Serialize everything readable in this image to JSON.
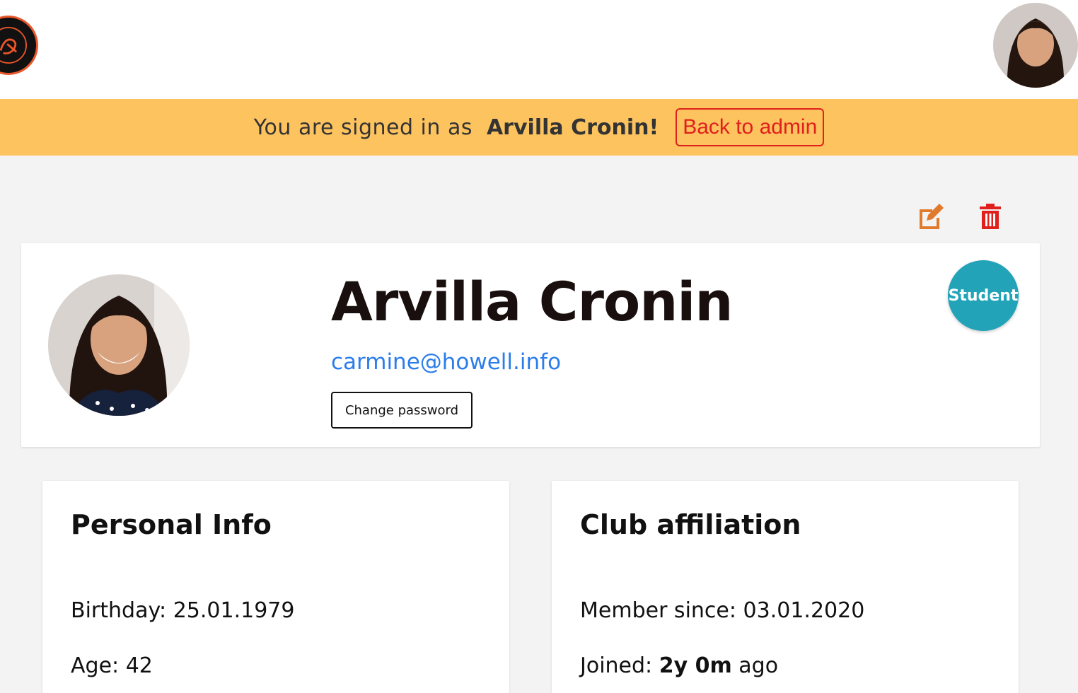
{
  "header": {
    "logo_icon": "club-logo-icon",
    "avatar_icon": "user-avatar"
  },
  "banner": {
    "prefix": "You are signed in as",
    "user": "Arvilla Cronin!",
    "back_label": "Back to admin",
    "color": "#fdc35f"
  },
  "actions": {
    "edit_icon": "edit-icon",
    "delete_icon": "trash-icon",
    "edit_color": "#e07b2d",
    "delete_color": "#e0201c"
  },
  "profile": {
    "name": "Arvilla Cronin",
    "email": "carmine@howell.info",
    "change_password_label": "Change password",
    "role": "Student",
    "role_color": "#22a3b8"
  },
  "personal_info": {
    "title": "Personal Info",
    "birthday_label": "Birthday:",
    "birthday": "25.01.1979",
    "age_label": "Age:",
    "age": "42"
  },
  "club_affiliation": {
    "title": "Club affiliation",
    "member_since_label": "Member since:",
    "member_since": "03.01.2020",
    "joined_label": "Joined:",
    "joined_value": "2y 0m",
    "joined_suffix": "ago"
  }
}
